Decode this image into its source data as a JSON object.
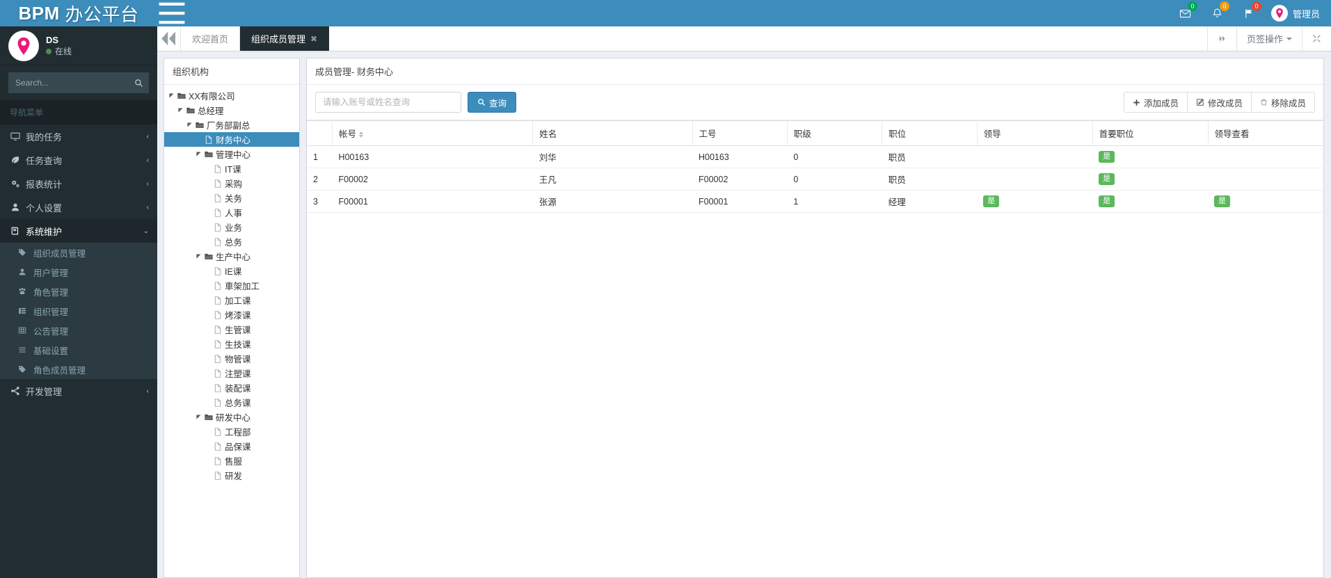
{
  "brand": {
    "strong": "BPM",
    "light": "办公平台"
  },
  "navbar": {
    "toggle_icon": "hamburger-icon",
    "icons": [
      {
        "name": "envelope-icon",
        "badge": "0",
        "badge_color": "#00a65a"
      },
      {
        "name": "bell-icon",
        "badge": "0",
        "badge_color": "#f39c12"
      },
      {
        "name": "flag-icon",
        "badge": "0",
        "badge_color": "#dd4b39"
      }
    ],
    "user_label": "管理员"
  },
  "sidebar": {
    "user": {
      "name": "DS",
      "status": "在线"
    },
    "search_placeholder": "Search...",
    "menu_header": "导航菜单",
    "menu": [
      {
        "label": "我的任务",
        "icon": "desktop-icon",
        "arrow": "‹",
        "open": false
      },
      {
        "label": "任务查询",
        "icon": "leaf-icon",
        "arrow": "‹",
        "open": false
      },
      {
        "label": "报表统计",
        "icon": "cogs-icon",
        "arrow": "‹",
        "open": false
      },
      {
        "label": "个人设置",
        "icon": "user-icon",
        "arrow": "‹",
        "open": false
      },
      {
        "label": "系统维护",
        "icon": "book-icon",
        "arrow": "⌄",
        "open": true
      },
      {
        "label": "开发管理",
        "icon": "share-icon",
        "arrow": "‹",
        "open": false
      }
    ],
    "submenu": [
      {
        "label": "组织成员管理",
        "icon": "tag-icon"
      },
      {
        "label": "用户管理",
        "icon": "user-icon"
      },
      {
        "label": "角色管理",
        "icon": "paw-icon"
      },
      {
        "label": "组织管理",
        "icon": "list-icon"
      },
      {
        "label": "公告管理",
        "icon": "table-icon"
      },
      {
        "label": "基础设置",
        "icon": "bars-icon"
      },
      {
        "label": "角色成员管理",
        "icon": "tag-icon"
      }
    ]
  },
  "tabs": {
    "prev_icon": "double-left-icon",
    "next_icon": "double-right-icon",
    "items": [
      {
        "label": "欢迎首页",
        "active": false,
        "closable": false
      },
      {
        "label": "组织成员管理",
        "active": true,
        "closable": true
      }
    ],
    "close_glyph": "✖",
    "ops_label": "页签操作",
    "fullscreen_icon": "expand-icon"
  },
  "tree": {
    "title": "组织机构",
    "nodes": [
      {
        "label": "XX有限公司",
        "depth": 0,
        "type": "folder",
        "toggle": true,
        "selected": false
      },
      {
        "label": "总经理",
        "depth": 1,
        "type": "folder",
        "toggle": true,
        "selected": false
      },
      {
        "label": "厂务部副总",
        "depth": 2,
        "type": "folder",
        "toggle": true,
        "selected": false
      },
      {
        "label": "财务中心",
        "depth": 3,
        "type": "file",
        "toggle": false,
        "selected": true
      },
      {
        "label": "管理中心",
        "depth": 3,
        "type": "folder",
        "toggle": true,
        "selected": false
      },
      {
        "label": "IT课",
        "depth": 4,
        "type": "file",
        "toggle": false,
        "selected": false
      },
      {
        "label": "采购",
        "depth": 4,
        "type": "file",
        "toggle": false,
        "selected": false
      },
      {
        "label": "关务",
        "depth": 4,
        "type": "file",
        "toggle": false,
        "selected": false
      },
      {
        "label": "人事",
        "depth": 4,
        "type": "file",
        "toggle": false,
        "selected": false
      },
      {
        "label": "业务",
        "depth": 4,
        "type": "file",
        "toggle": false,
        "selected": false
      },
      {
        "label": "总务",
        "depth": 4,
        "type": "file",
        "toggle": false,
        "selected": false
      },
      {
        "label": "生产中心",
        "depth": 3,
        "type": "folder",
        "toggle": true,
        "selected": false
      },
      {
        "label": "IE课",
        "depth": 4,
        "type": "file",
        "toggle": false,
        "selected": false
      },
      {
        "label": "車架加工",
        "depth": 4,
        "type": "file",
        "toggle": false,
        "selected": false
      },
      {
        "label": "加工课",
        "depth": 4,
        "type": "file",
        "toggle": false,
        "selected": false
      },
      {
        "label": "烤漆课",
        "depth": 4,
        "type": "file",
        "toggle": false,
        "selected": false
      },
      {
        "label": "生管课",
        "depth": 4,
        "type": "file",
        "toggle": false,
        "selected": false
      },
      {
        "label": "生技课",
        "depth": 4,
        "type": "file",
        "toggle": false,
        "selected": false
      },
      {
        "label": "物管课",
        "depth": 4,
        "type": "file",
        "toggle": false,
        "selected": false
      },
      {
        "label": "注塑课",
        "depth": 4,
        "type": "file",
        "toggle": false,
        "selected": false
      },
      {
        "label": "装配课",
        "depth": 4,
        "type": "file",
        "toggle": false,
        "selected": false
      },
      {
        "label": "总务课",
        "depth": 4,
        "type": "file",
        "toggle": false,
        "selected": false
      },
      {
        "label": "研发中心",
        "depth": 3,
        "type": "folder",
        "toggle": true,
        "selected": false
      },
      {
        "label": "工程部",
        "depth": 4,
        "type": "file",
        "toggle": false,
        "selected": false
      },
      {
        "label": "品保课",
        "depth": 4,
        "type": "file",
        "toggle": false,
        "selected": false
      },
      {
        "label": "售服",
        "depth": 4,
        "type": "file",
        "toggle": false,
        "selected": false
      },
      {
        "label": "研发",
        "depth": 4,
        "type": "file",
        "toggle": false,
        "selected": false
      }
    ]
  },
  "main": {
    "title": "成员管理- 财务中心",
    "search_placeholder": "请输入账号或姓名查询",
    "search_value": "",
    "query_button": "查询",
    "actions": [
      {
        "label": "添加成员",
        "icon": "plus-icon"
      },
      {
        "label": "修改成员",
        "icon": "edit-icon"
      },
      {
        "label": "移除成员",
        "icon": "trash-icon"
      }
    ],
    "table": {
      "columns": [
        {
          "label": "",
          "key": "idx",
          "cls": "col-idx"
        },
        {
          "label": "帐号",
          "key": "account",
          "cls": "w-acct",
          "sortable": true
        },
        {
          "label": "姓名",
          "key": "name",
          "cls": "w-name"
        },
        {
          "label": "工号",
          "key": "empno",
          "cls": "w-eno"
        },
        {
          "label": "职级",
          "key": "rank",
          "cls": "w-rank"
        },
        {
          "label": "职位",
          "key": "position",
          "cls": "w-pos"
        },
        {
          "label": "领导",
          "key": "leader",
          "cls": "w-lead"
        },
        {
          "label": "首要职位",
          "key": "primary",
          "cls": "w-prim"
        },
        {
          "label": "领导查看",
          "key": "leaderview",
          "cls": "w-view"
        }
      ],
      "badge_yes": "是",
      "badge_color": "#5cb85c",
      "rows": [
        {
          "idx": "1",
          "account": "H00163",
          "name": "刘华",
          "empno": "H00163",
          "rank": "0",
          "position": "职员",
          "leader": false,
          "primary": true,
          "leaderview": false
        },
        {
          "idx": "2",
          "account": "F00002",
          "name": "王凡",
          "empno": "F00002",
          "rank": "0",
          "position": "职员",
          "leader": false,
          "primary": true,
          "leaderview": false
        },
        {
          "idx": "3",
          "account": "F00001",
          "name": "张源",
          "empno": "F00001",
          "rank": "1",
          "position": "经理",
          "leader": true,
          "primary": true,
          "leaderview": true
        }
      ]
    }
  },
  "colors": {
    "primary": "#3c8dbc",
    "sidebar": "#222d32",
    "success": "#5cb85c",
    "warning": "#f39c12",
    "danger": "#dd4b39",
    "brand_pink": "#e9197b"
  }
}
